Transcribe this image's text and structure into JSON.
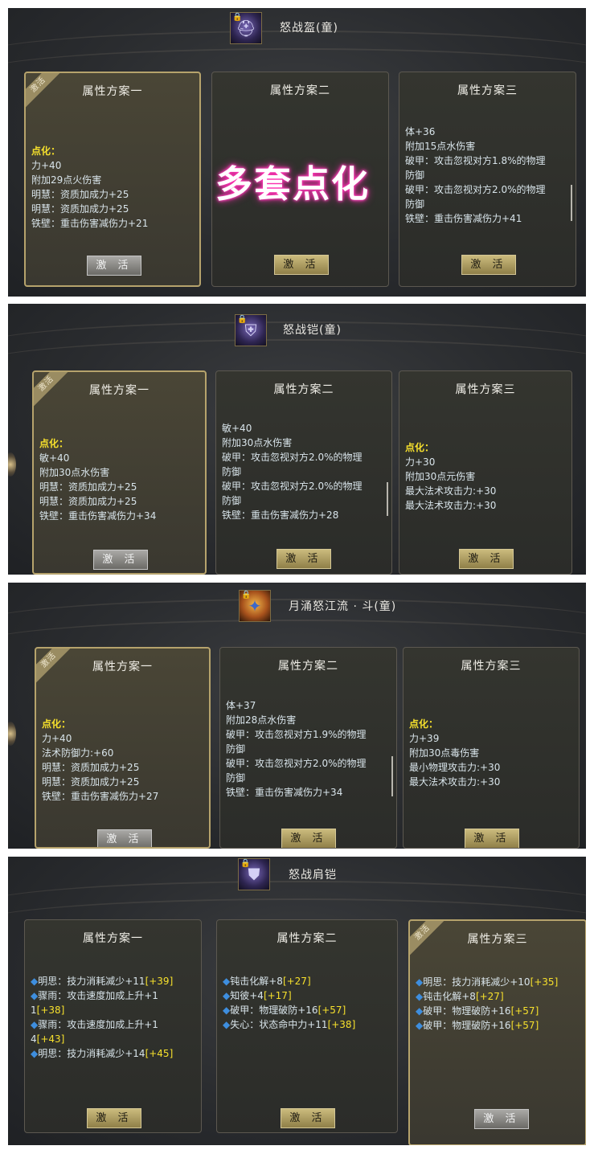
{
  "watermark": "多套点化",
  "panels": [
    {
      "item": {
        "name": "怒战盔(童)",
        "icon": "helmet-icon"
      },
      "cards": [
        {
          "title": "属性方案一",
          "badge": "激活",
          "lines": [
            "点化：",
            "力+40",
            "附加29点火伤害",
            "明慧：资质加成力+25",
            "明慧：资质加成力+25",
            "铁壁：重击伤害减伤力+21"
          ],
          "button": "激 活"
        },
        {
          "title": "属性方案二",
          "lines": [],
          "button": "激 活"
        },
        {
          "title": "属性方案三",
          "lines": [
            "体+36",
            "附加15点水伤害",
            "破甲：攻击忽视对方1.8%的物理",
            "防御",
            "破甲：攻击忽视对方2.0%的物理",
            "防御",
            "铁壁：重击伤害减伤力+41"
          ],
          "button": "激 活"
        }
      ]
    },
    {
      "item": {
        "name": "怒战铠(童)",
        "icon": "armor-icon"
      },
      "cards": [
        {
          "title": "属性方案一",
          "badge": "激活",
          "lines": [
            "点化：",
            "敏+40",
            "附加30点水伤害",
            "明慧：资质加成力+25",
            "明慧：资质加成力+25",
            "铁壁：重击伤害减伤力+34"
          ],
          "button": "激 活"
        },
        {
          "title": "属性方案二",
          "lines": [
            "敏+40",
            "附加30点水伤害",
            "破甲：攻击忽视对方2.0%的物理",
            "防御",
            "破甲：攻击忽视对方2.0%的物理",
            "防御",
            "铁壁：重击伤害减伤力+28"
          ],
          "button": "激 活"
        },
        {
          "title": "属性方案三",
          "lines": [
            "点化：",
            "力+30",
            "附加30点元伤害",
            "最大法术攻击力:+30",
            "最大法术攻击力:+30"
          ],
          "button": "激 活"
        }
      ]
    },
    {
      "item": {
        "name": "月涌怒江流 · 斗(童)",
        "icon": "weapon-icon"
      },
      "cards": [
        {
          "title": "属性方案一",
          "badge": "激活",
          "lines": [
            "点化：",
            "力+40",
            "法术防御力:+60",
            "明慧：资质加成力+25",
            "明慧：资质加成力+25",
            "铁壁：重击伤害减伤力+27"
          ],
          "button": "激 活"
        },
        {
          "title": "属性方案二",
          "lines": [
            "体+37",
            "附加28点水伤害",
            "破甲：攻击忽视对方1.9%的物理",
            "防御",
            "破甲：攻击忽视对方2.0%的物理",
            "防御",
            "铁壁：重击伤害减伤力+34"
          ],
          "button": "激 活"
        },
        {
          "title": "属性方案三",
          "lines": [
            "点化：",
            "力+39",
            "附加30点毒伤害",
            "最小物理攻击力:+30",
            "最大法术攻击力:+30"
          ],
          "button": "激 活"
        }
      ]
    },
    {
      "item": {
        "name": "怒战肩铠",
        "icon": "shoulder-armor-icon"
      },
      "cards": [
        {
          "title": "属性方案一",
          "lines": [
            {
              "bullet": "◆",
              "text": "明思：技力消耗减少+11",
              "bonus": "[+39]"
            },
            {
              "bullet": "◆",
              "text": "骤雨：攻击速度加成上升+1"
            },
            {
              "text": "1",
              "bonus": "[+38]"
            },
            {
              "bullet": "◆",
              "text": "骤雨：攻击速度加成上升+1"
            },
            {
              "text": "4",
              "bonus": "[+43]"
            },
            {
              "bullet": "◆",
              "text": "明思：技力消耗减少+14",
              "bonus": "[+45]"
            }
          ],
          "button": "激 活"
        },
        {
          "title": "属性方案二",
          "lines": [
            {
              "bullet": "◆",
              "text": "钝击化解+8",
              "bonus": "[+27]"
            },
            {
              "bullet": "◆",
              "text": "知彼+4",
              "bonus": "[+17]"
            },
            {
              "bullet": "◆",
              "text": "破甲：物理破防+16",
              "bonus": "[+57]"
            },
            {
              "bullet": "◆",
              "text": "失心：状态命中力+11",
              "bonus": "[+38]"
            }
          ],
          "button": "激 活"
        },
        {
          "title": "属性方案三",
          "badge": "激活",
          "lines": [
            {
              "bullet": "◆",
              "text": "明思：技力消耗减少+10",
              "bonus": "[+35]"
            },
            {
              "bullet": "◆",
              "text": "钝击化解+8",
              "bonus": "[+27]"
            },
            {
              "bullet": "◆",
              "text": "破甲：物理破防+16",
              "bonus": "[+57]"
            },
            {
              "bullet": "◆",
              "text": "破甲：物理破防+16",
              "bonus": "[+57]"
            }
          ],
          "button": "激 活"
        }
      ]
    }
  ]
}
